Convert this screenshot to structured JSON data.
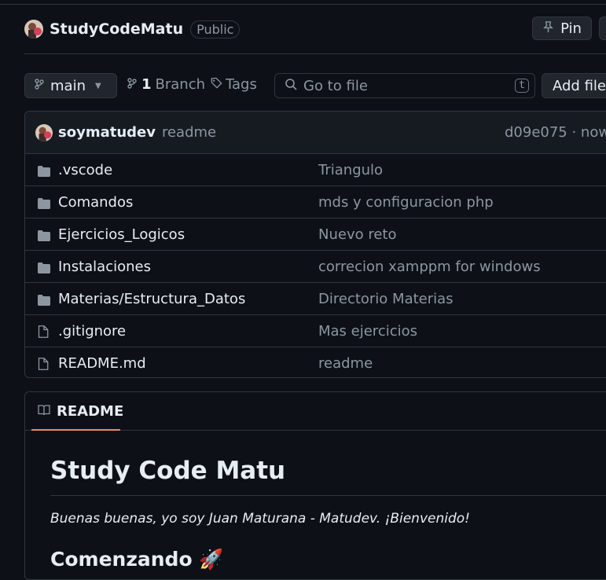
{
  "repo": {
    "name": "StudyCodeMatu",
    "visibility": "Public"
  },
  "header_actions": {
    "pin_label": "Pin"
  },
  "toolbar": {
    "branch_name": "main",
    "branch_count": "1",
    "branch_label": "Branch",
    "tags_label": "Tags",
    "search_placeholder": "Go to file",
    "search_shortcut": "t",
    "add_file_label": "Add file"
  },
  "latest_commit": {
    "author": "soymatudev",
    "message": "readme",
    "hash_time": "d09e075 · now"
  },
  "files": [
    {
      "type": "folder",
      "name": ".vscode",
      "message": "Triangulo"
    },
    {
      "type": "folder",
      "name": "Comandos",
      "message": "mds y configuracion php"
    },
    {
      "type": "folder",
      "name": "Ejercicios_Logicos",
      "message": "Nuevo reto"
    },
    {
      "type": "folder",
      "name": "Instalaciones",
      "message": "correcion xamppm for windows"
    },
    {
      "type": "folder",
      "name": "Materias/Estructura_Datos",
      "message": "Directorio Materias"
    },
    {
      "type": "file",
      "name": ".gitignore",
      "message": "Mas ejercicios"
    },
    {
      "type": "file",
      "name": "README.md",
      "message": "readme"
    }
  ],
  "readme": {
    "tab_label": "README",
    "title": "Study Code Matu",
    "intro": "Buenas buenas, yo soy Juan Maturana - Matudev. ¡Bienvenido!",
    "section_heading": "Comenzando 🚀"
  },
  "colors": {
    "background": "#0d1117",
    "border": "#30363d",
    "muted": "#8d96a0",
    "accent_underline": "#f78166"
  },
  "icons": {
    "pin": "pin-icon",
    "branch": "git-branch-icon",
    "tag": "tag-icon",
    "search": "search-icon",
    "folder": "folder-icon",
    "file": "file-icon",
    "book": "book-icon"
  }
}
